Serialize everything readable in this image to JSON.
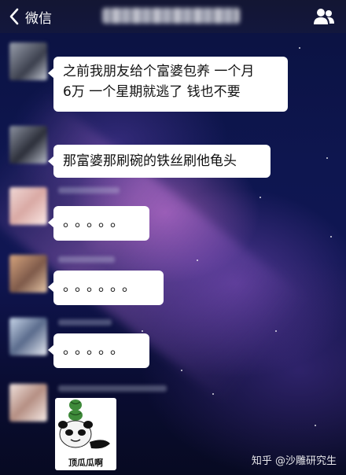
{
  "header": {
    "back_label": "微信"
  },
  "messages": [
    {
      "type": "text",
      "text_line1": "之前我朋友给个富婆包养 一个月",
      "text_line2": "6万 一个星期就逃了 钱也不要"
    },
    {
      "type": "text",
      "text": "那富婆那刷碗的铁丝刷他龟头"
    },
    {
      "type": "text",
      "text": "。。。。。"
    },
    {
      "type": "text",
      "text": "。。。。。。"
    },
    {
      "type": "text",
      "text": "。。。。。"
    },
    {
      "type": "sticker",
      "caption": "顶瓜瓜啊"
    }
  ],
  "watermark": "知乎 @沙雕研究生",
  "colors": {
    "bubble": "#ffffff",
    "header_text": "#ffffff",
    "background": "#0e1650"
  },
  "icons": {
    "back": "chevron-left-icon",
    "contacts": "group-contacts-icon"
  }
}
